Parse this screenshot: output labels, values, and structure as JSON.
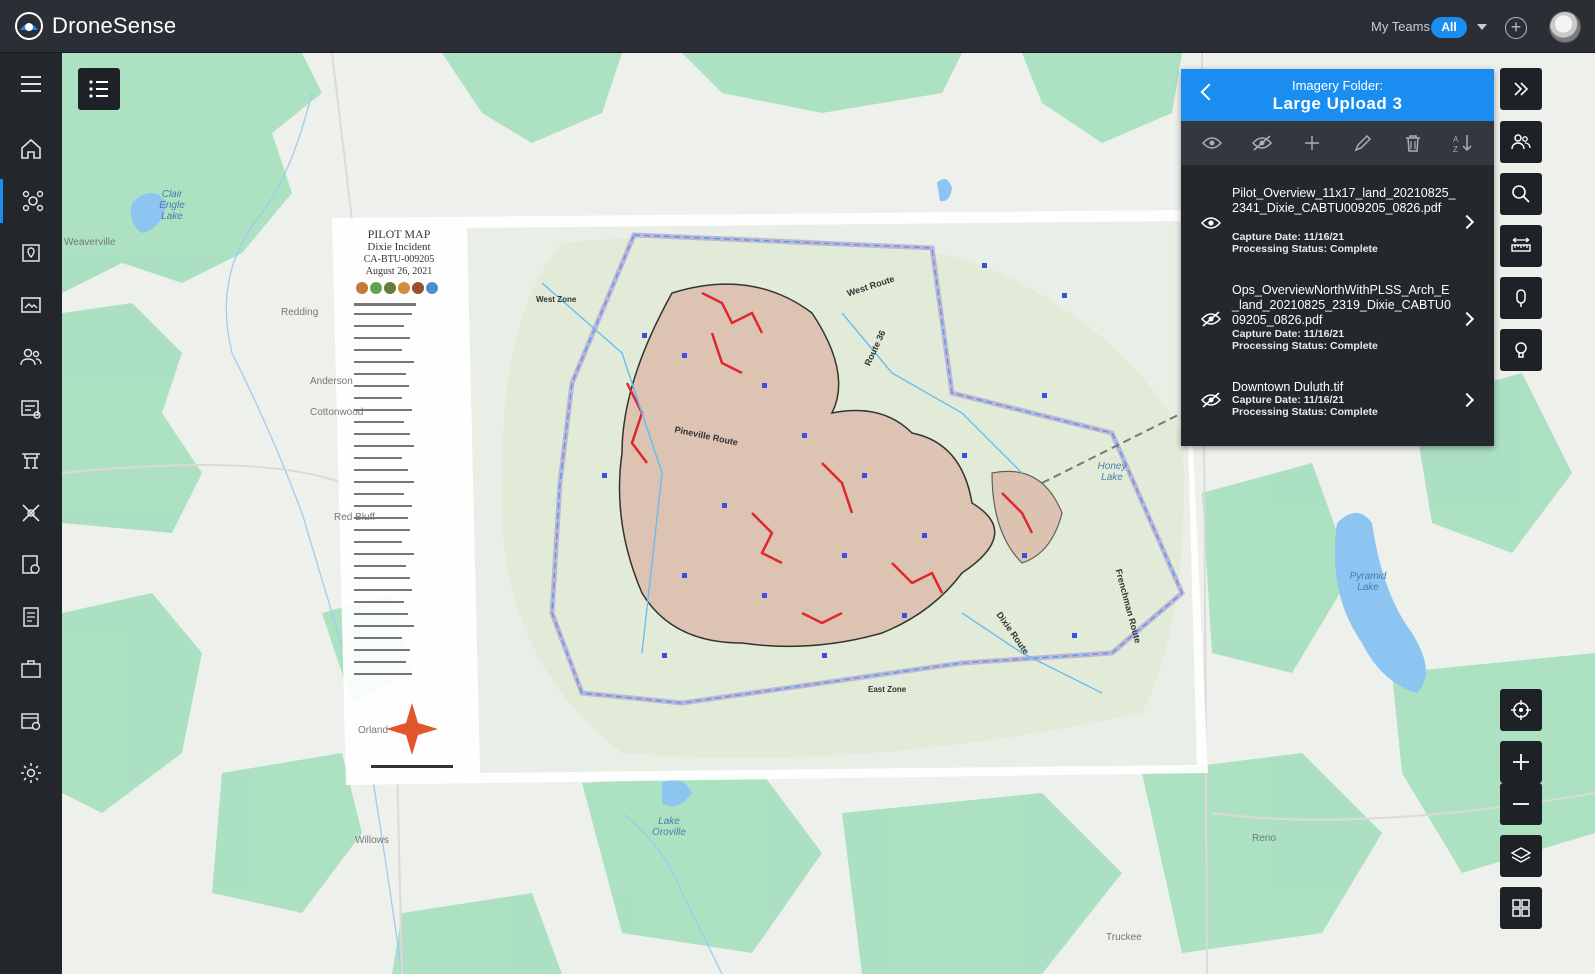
{
  "app": {
    "name": "DroneSense"
  },
  "header": {
    "teams_label": "My Teams",
    "teams_value": "All"
  },
  "sidebar": {
    "items": [
      {
        "icon": "menu-icon"
      },
      {
        "icon": "home-icon"
      },
      {
        "icon": "drone-ops-icon",
        "active": true
      },
      {
        "icon": "map-pin-icon"
      },
      {
        "icon": "media-icon"
      },
      {
        "icon": "people-icon"
      },
      {
        "icon": "checklist-icon"
      },
      {
        "icon": "aircraft-icon"
      },
      {
        "icon": "tools-icon"
      },
      {
        "icon": "badge-icon"
      },
      {
        "icon": "document-icon"
      },
      {
        "icon": "briefcase-icon"
      },
      {
        "icon": "calendar-icon"
      },
      {
        "icon": "settings-icon"
      }
    ]
  },
  "map": {
    "labels": {
      "clair_engle": "Clair Engle Lake",
      "weaverville": "Weaverville",
      "redding": "Redding",
      "anderson": "Anderson",
      "cottonwood": "Cottonwood",
      "red_bluff": "Red Bluff",
      "orland": "Orland",
      "willows": "Willows",
      "lake_oroville": "Lake Oroville",
      "pyramid_lake": "Pyramid Lake",
      "reno": "Reno",
      "truckee": "Truckee",
      "honey_lake": "Honey Lake"
    },
    "overlay": {
      "title": "PILOT MAP",
      "incident": "Dixie Incident",
      "id": "CA-BTU-009205",
      "date": "August 26, 2021",
      "zones": [
        "West Zone",
        "West Route",
        "Route 36",
        "Pineville Route",
        "East Zone",
        "Dixie Route",
        "Frenchman Route"
      ]
    }
  },
  "panel": {
    "folder_label": "Imagery Folder:",
    "folder_name": "Large Upload 3",
    "files": [
      {
        "name": "Pilot_Overview_11x17_land_20210825_2341_Dixie_CABTU009205_0826.pdf",
        "capture": "Capture Date: 11/16/21",
        "status": "Processing Status: Complete",
        "visible": true
      },
      {
        "name": "Ops_OverviewNorthWithPLSS_Arch_E_land_20210825_2319_Dixie_CABTU009205_0826.pdf",
        "capture": "Capture Date: 11/16/21",
        "status": "Processing Status: Complete",
        "visible": false
      },
      {
        "name": "Downtown Duluth.tif",
        "capture": "Capture Date: 11/16/21",
        "status": "Processing Status: Complete",
        "visible": false
      }
    ]
  },
  "colors": {
    "accent": "#1a8df0",
    "topbar": "#2b2f35",
    "sidebar": "#23272c",
    "panel": "#24282d",
    "map_green": "#a8e0c0",
    "water": "#8cc4f2"
  }
}
